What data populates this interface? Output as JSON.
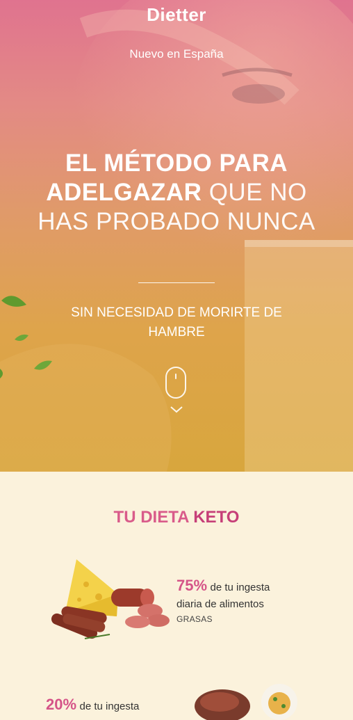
{
  "brand": "Dietter",
  "tagline": "Nuevo en España",
  "headline": {
    "strong": "EL MÉTODO PARA ADELGAZAR",
    "light": "QUE NO HAS PROBADO NUNCA"
  },
  "subheadline": "SIN NECESIDAD DE MORIRTE DE HAMBRE",
  "section": {
    "title_prefix": "TU DIETA",
    "title_emphasis": "KETO",
    "stats": [
      {
        "percent": "75%",
        "text_line1": "de tu ingesta",
        "text_line2": "diaria de alimentos",
        "caption": "GRASAS"
      },
      {
        "percent": "20%",
        "text_line1": "de tu ingesta"
      }
    ]
  },
  "colors": {
    "accent": "#d55488",
    "cream": "#fbf2dc"
  }
}
